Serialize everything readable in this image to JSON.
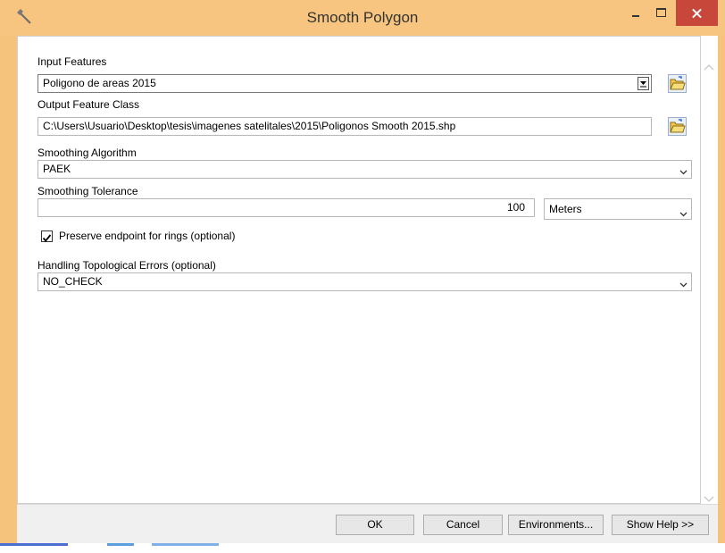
{
  "window": {
    "title": "Smooth Polygon",
    "icon": "hammer-icon"
  },
  "form": {
    "input_features": {
      "label": "Input Features",
      "value": "Poligono de areas 2015"
    },
    "output_feature_class": {
      "label": "Output Feature Class",
      "value": "C:\\Users\\Usuario\\Desktop\\tesis\\imagenes satelitales\\2015\\Poligonos Smooth 2015.shp"
    },
    "smoothing_algorithm": {
      "label": "Smoothing Algorithm",
      "value": "PAEK"
    },
    "smoothing_tolerance": {
      "label": "Smoothing Tolerance",
      "value": "100",
      "unit": "Meters"
    },
    "preserve_endpoint": {
      "label": "Preserve endpoint for rings (optional)",
      "checked": true
    },
    "handling_topological_errors": {
      "label": "Handling Topological Errors (optional)",
      "value": "NO_CHECK"
    }
  },
  "buttons": {
    "ok": "OK",
    "cancel": "Cancel",
    "environments": "Environments...",
    "show_help": "Show Help >>"
  },
  "colors": {
    "title_bar": "#f7c57f",
    "close_button": "#c7483b"
  }
}
